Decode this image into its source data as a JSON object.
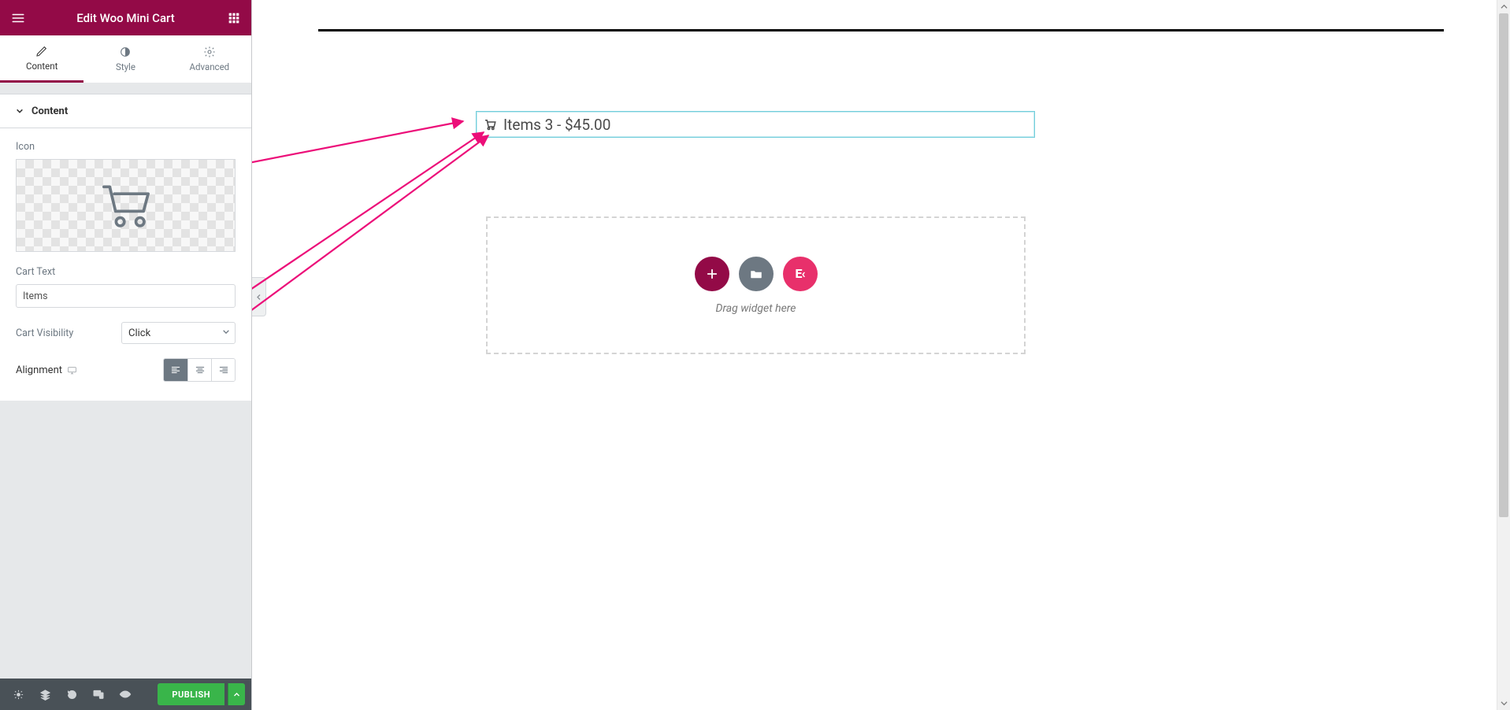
{
  "header": {
    "title": "Edit Woo Mini Cart"
  },
  "tabs": {
    "content": "Content",
    "style": "Style",
    "advanced": "Advanced",
    "active": "content"
  },
  "section": {
    "title": "Content"
  },
  "controls": {
    "icon_label": "Icon",
    "cart_text_label": "Cart Text",
    "cart_text_value": "Items",
    "cart_visibility_label": "Cart Visibility",
    "cart_visibility_value": "Click",
    "alignment_label": "Alignment",
    "alignment_value": "left"
  },
  "footer": {
    "publish_label": "PUBLISH"
  },
  "canvas": {
    "mini_cart_text": "Items 3 - $45.00",
    "drop_hint": "Drag widget here",
    "ek_label": "E‹"
  }
}
